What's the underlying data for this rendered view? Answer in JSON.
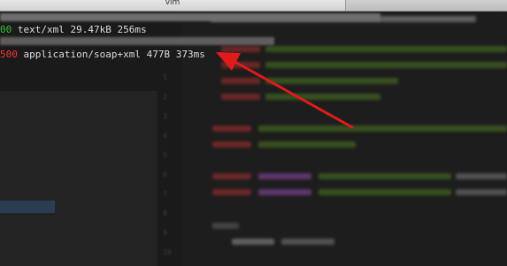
{
  "window": {
    "tab_title": "vim"
  },
  "terminal": {
    "lines": [
      {
        "status": "00",
        "status_color": "#41c441",
        "content_type": "text/xml",
        "size": "29.47kB",
        "time": "256ms"
      },
      {
        "status": "500",
        "status_color": "#ff3b3b",
        "content_type": "application/soap+xml",
        "size": "477B",
        "time": "373ms"
      }
    ]
  },
  "annotation": {
    "arrow_color": "#e01b1b",
    "points_to": "terminal line 2 (500 application/soap+xml 477B 373ms)"
  },
  "colors": {
    "editor_background": "#1d1d1d",
    "success": "#41c441",
    "error": "#ff3b3b"
  }
}
